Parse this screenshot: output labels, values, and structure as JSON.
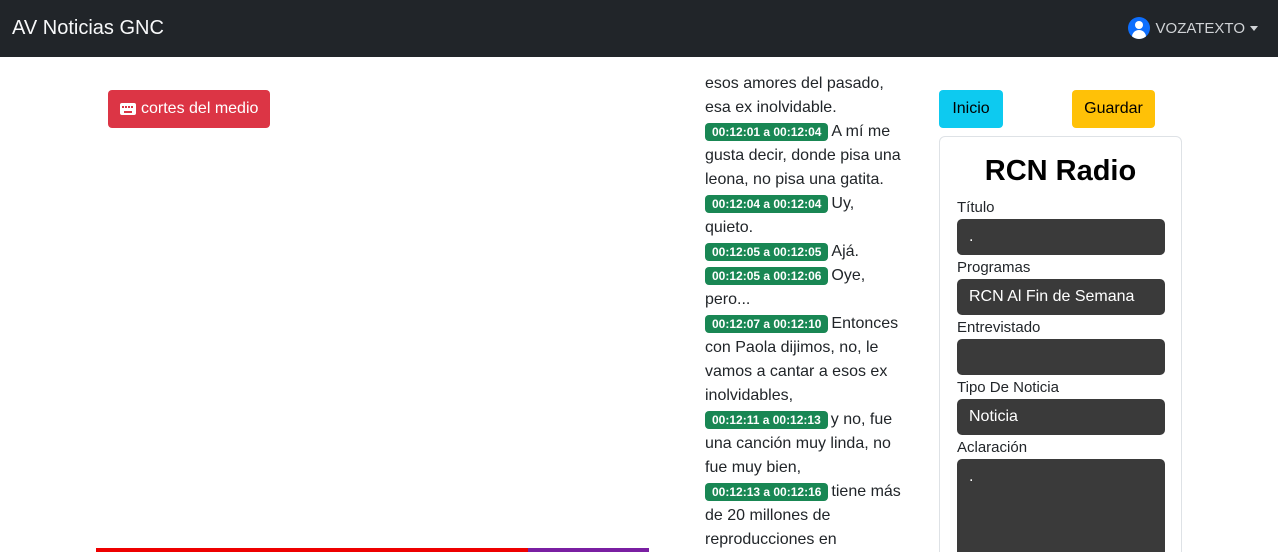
{
  "navbar": {
    "brand": "AV Noticias GNC",
    "user": "VOZATEXTO"
  },
  "cortes_button": "cortes del medio",
  "transcript": {
    "lead_lines": [
      "esos amores del pasado,",
      "esa ex inolvidable."
    ],
    "entries": [
      {
        "time": "00:12:01 a 00:12:04",
        "text": "A mí me gusta decir, donde pisa una leona, no pisa una gatita."
      },
      {
        "time": "00:12:04 a 00:12:04",
        "text": "Uy, quieto."
      },
      {
        "time": "00:12:05 a 00:12:05",
        "text": "Ajá."
      },
      {
        "time": "00:12:05 a 00:12:06",
        "text": "Oye, pero..."
      },
      {
        "time": "00:12:07 a 00:12:10",
        "text": "Entonces con Paola dijimos, no, le vamos a cantar a esos ex inolvidables,"
      },
      {
        "time": "00:12:11 a 00:12:13",
        "text": "y no, fue una canción muy linda, no fue muy bien,"
      },
      {
        "time": "00:12:13 a 00:12:16",
        "text": "tiene más de 20 millones de reproducciones en"
      }
    ]
  },
  "actions": {
    "inicio": "Inicio",
    "guardar": "Guardar"
  },
  "form": {
    "title": "RCN Radio",
    "titulo_label": "Título",
    "titulo_value": ".",
    "programas_label": "Programas",
    "programas_value": "RCN Al Fin de Semana",
    "entrevistado_label": "Entrevistado",
    "entrevistado_value": "",
    "tipo_label": "Tipo De Noticia",
    "tipo_value": "Noticia",
    "aclaracion_label": "Aclaración",
    "aclaracion_value": "."
  },
  "colors": {
    "navbar": "#212529",
    "danger": "#dc3545",
    "info": "#0dcaf0",
    "warning": "#ffc107",
    "success": "#198754"
  }
}
